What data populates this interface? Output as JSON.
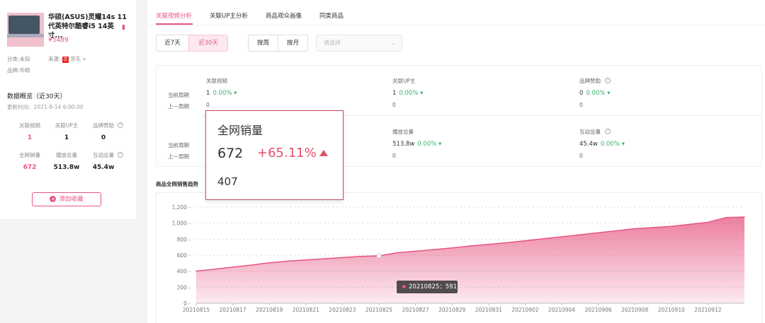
{
  "product": {
    "title": "华硕(ASUS)灵耀14s 11代英特尔酷睿i5 14英寸...",
    "flag": "📕",
    "price": "¥5489",
    "category_label": "分类:",
    "category_value": "未知",
    "source_label": "来源:",
    "source_badge": "京",
    "source_value": "京东 »",
    "brand_label": "品牌:",
    "brand_value": "华硕"
  },
  "overview": {
    "title": "数据概览（近30天）",
    "update_time": "更新时间：2021-9-14 6:00:00",
    "stats": [
      {
        "label": "关联视频",
        "value": "1",
        "highlight": true,
        "help": false
      },
      {
        "label": "关联UP主",
        "value": "1",
        "highlight": false,
        "help": false
      },
      {
        "label": "品牌赞助",
        "value": "0",
        "highlight": false,
        "help": true
      },
      {
        "label": "全网销量",
        "value": "672",
        "highlight": true,
        "help": false
      },
      {
        "label": "播放总量",
        "value": "513.8w",
        "highlight": false,
        "help": false
      },
      {
        "label": "互动总量",
        "value": "45.4w",
        "highlight": false,
        "help": true
      }
    ],
    "fav_button": "添加收藏"
  },
  "tabs": [
    "关联视频分析",
    "关联UP主分析",
    "商品观众画像",
    "同类商品"
  ],
  "filters": {
    "range_7": "近7天",
    "range_30": "近30天",
    "by_week": "按周",
    "by_month": "按月",
    "select_placeholder": "请选择"
  },
  "metrics": {
    "current_label": "当前周期",
    "prev_label": "上一周期",
    "row1": [
      {
        "title": "关联视频",
        "value": "1",
        "pct": "0.00% ▾",
        "prev": "0",
        "help": false
      },
      {
        "title": "关联UP主",
        "value": "1",
        "pct": "0.00% ▾",
        "prev": "0",
        "help": false
      },
      {
        "title": "品牌赞助",
        "value": "0",
        "pct": "0.00% ▾",
        "prev": "0",
        "help": true
      }
    ],
    "row2": [
      {
        "title": "播放总量",
        "value": "513.8w",
        "pct": "0.00% ▾",
        "prev": "0",
        "help": false
      },
      {
        "title": "互动总量",
        "value": "45.4w",
        "pct": "0.00% ▾",
        "prev": "0",
        "help": true
      }
    ]
  },
  "popup": {
    "title": "全网销量",
    "value": "672",
    "pct": "+65.11%",
    "prev": "407"
  },
  "chart_title": "商品全网销售趋势",
  "tooltip": "20210825：591",
  "chart_data": {
    "type": "area",
    "title": "商品全网销售趋势",
    "xlabel": "",
    "ylabel": "",
    "ylim": [
      0,
      1200
    ],
    "yticks": [
      0,
      200,
      400,
      600,
      800,
      1000,
      1200
    ],
    "ytick_labels": [
      "0",
      "200",
      "400",
      "600",
      "800",
      "1,000",
      "1,200"
    ],
    "x": [
      "20210815",
      "20210816",
      "20210817",
      "20210818",
      "20210819",
      "20210820",
      "20210821",
      "20210822",
      "20210823",
      "20210824",
      "20210825",
      "20210826",
      "20210827",
      "20210828",
      "20210829",
      "20210830",
      "20210831",
      "20210901",
      "20210902",
      "20210903",
      "20210904",
      "20210905",
      "20210906",
      "20210907",
      "20210908",
      "20210909",
      "20210910",
      "20210911",
      "20210912",
      "20210913",
      "20210914"
    ],
    "x_tick_labels": [
      "20210815",
      "20210817",
      "20210819",
      "20210821",
      "20210823",
      "20210825",
      "20210827",
      "20210829",
      "20210831",
      "20210902",
      "20210904",
      "20210906",
      "20210908",
      "20210910",
      "20210912"
    ],
    "values": [
      400,
      425,
      450,
      475,
      505,
      525,
      540,
      555,
      570,
      585,
      591,
      630,
      650,
      670,
      690,
      715,
      735,
      755,
      780,
      805,
      830,
      855,
      880,
      905,
      930,
      945,
      960,
      985,
      1010,
      1070,
      1075
    ],
    "highlight_x": "20210825",
    "color": "#e75480",
    "grid": true
  }
}
